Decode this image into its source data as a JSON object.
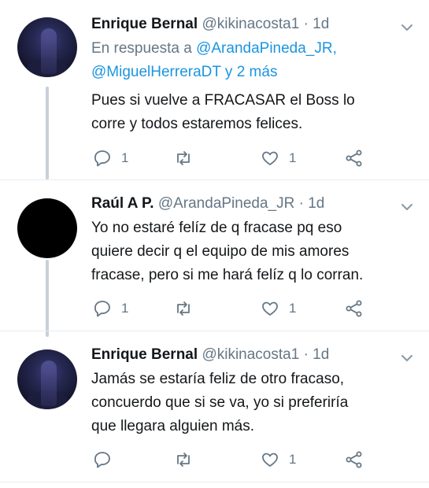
{
  "colors": {
    "text": "#14171a",
    "secondary": "#657786",
    "link": "#1b95e0",
    "thread_line": "#c7d0d8"
  },
  "tweets": [
    {
      "name": "Enrique Bernal",
      "handle": "@kikinacosta1",
      "separator": "·",
      "time": "1d",
      "reply_prefix": "En respuesta a ",
      "reply_mention_1": "@ArandaPineda_JR,",
      "reply_mention_2": "@MiguelHerreraDT",
      "reply_suffix": " y 2 más",
      "lines": [
        "Pues si vuelve a FRACASAR el Boss lo",
        "corre y todos estaremos felices."
      ],
      "reply_count": "1",
      "retweet_count": "",
      "like_count": "1"
    },
    {
      "name": "Raúl A P.",
      "handle": "@ArandaPineda_JR",
      "separator": "·",
      "time": "1d",
      "lines": [
        "Yo no estaré felíz de q fracase pq eso",
        "quiere decir q el equipo de mis amores",
        "fracase, pero si me hará felíz q lo corran."
      ],
      "reply_count": "1",
      "retweet_count": "",
      "like_count": "1"
    },
    {
      "name": "Enrique Bernal",
      "handle": "@kikinacosta1",
      "separator": "·",
      "time": "1d",
      "lines": [
        "Jamás se estaría feliz de otro fracaso,",
        "concuerdo que si se va, yo si preferiría",
        "que llegara alguien más."
      ],
      "reply_count": "",
      "retweet_count": "",
      "like_count": "1"
    }
  ],
  "icons": {
    "reply": "reply-icon",
    "retweet": "retweet-icon",
    "like": "heart-icon",
    "share": "share-icon",
    "menu": "chevron-down-icon"
  }
}
